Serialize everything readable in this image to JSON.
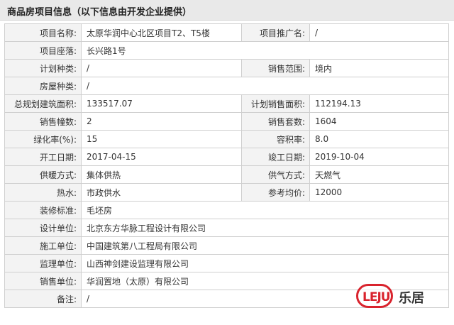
{
  "header": {
    "title": "商品房项目信息（以下信息由开发企业提供）"
  },
  "rows": [
    {
      "label": "项目名称:",
      "value": "太原华润中心北区项目T2、T5楼",
      "label2": "项目推广名:",
      "value2": "/"
    },
    {
      "label": "项目座落:",
      "value": "长兴路1号"
    },
    {
      "label": "计划种类:",
      "value": "/",
      "label2": "销售范围:",
      "value2": "境内"
    },
    {
      "label": "房屋种类:",
      "value": "/"
    },
    {
      "label": "总规划建筑面积:",
      "value": "133517.07",
      "label2": "计划销售面积:",
      "value2": "112194.13"
    },
    {
      "label": "销售幢数:",
      "value": "2",
      "label2": "销售套数:",
      "value2": "1604"
    },
    {
      "label": "绿化率(%):",
      "value": "15",
      "label2": "容积率:",
      "value2": "8.0"
    },
    {
      "label": "开工日期:",
      "value": "2017-04-15",
      "label2": "竣工日期:",
      "value2": "2019-10-04"
    },
    {
      "label": "供暖方式:",
      "value": "集体供热",
      "label2": "供气方式:",
      "value2": "天燃气"
    },
    {
      "label": "热水:",
      "value": "市政供水",
      "label2": "参考均价:",
      "value2": "12000"
    },
    {
      "label": "装修标准:",
      "value": "毛坯房"
    },
    {
      "label": "设计单位:",
      "value": "北京东方华脉工程设计有限公司"
    },
    {
      "label": "施工单位:",
      "value": "中国建筑第八工程局有限公司"
    },
    {
      "label": "监理单位:",
      "value": "山西神剑建设监理有限公司"
    },
    {
      "label": "销售单位:",
      "value": "华润置地（太原）有限公司"
    },
    {
      "label": "备注:",
      "value": "/"
    }
  ],
  "watermark": {
    "logo_text": "LEJU",
    "brand_text": "乐居"
  }
}
